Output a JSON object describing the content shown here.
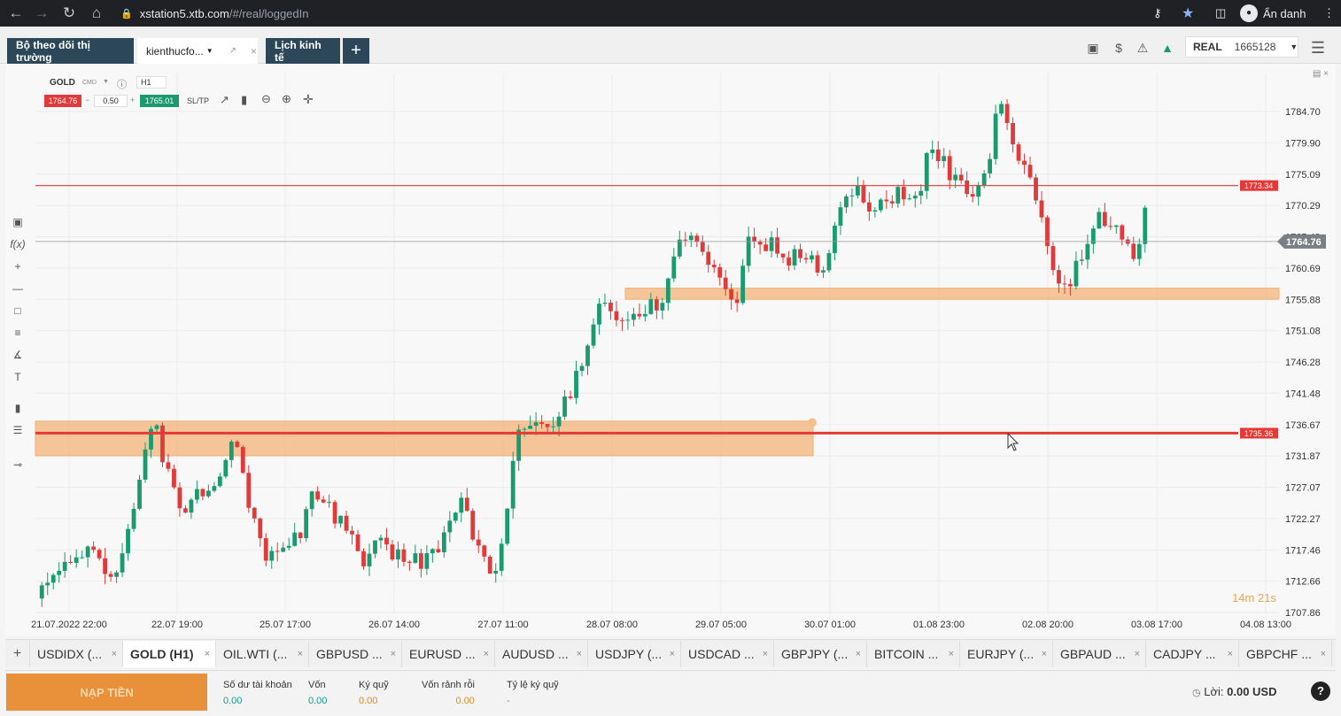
{
  "browser": {
    "url_host": "xstation5.xtb.com",
    "url_path": "/#/real/loggedIn",
    "profile_label": "Ẩn danh"
  },
  "header": {
    "tabs": [
      {
        "label": "Bộ theo dõi thị trường"
      },
      {
        "label": "kienthucfo...",
        "dropdown": true
      },
      {
        "label": "Lịch kinh tế"
      }
    ],
    "add_tab": "+",
    "account_type": "REAL",
    "account_number": "1665128"
  },
  "instrument": {
    "symbol": "GOLD",
    "type": "CMD",
    "timeframe": "H1",
    "sell_price": "1764.76",
    "volume": "0.50",
    "buy_price": "1765.01",
    "sltp_label": "SL/TP"
  },
  "chart_data": {
    "type": "candlestick",
    "y_axis_ticks": [
      "1784.70",
      "1779.90",
      "1775.09",
      "1770.29",
      "1765.49",
      "1760.69",
      "1755.88",
      "1751.08",
      "1746.28",
      "1741.48",
      "1736.67",
      "1731.87",
      "1727.07",
      "1722.27",
      "1717.46",
      "1712.66",
      "1707.86"
    ],
    "x_axis_ticks": [
      "21.07.2022 22:00",
      "22.07 19:00",
      "25.07 17:00",
      "26.07 14:00",
      "27.07 11:00",
      "28.07 08:00",
      "29.07 05:00",
      "30.07 01:00",
      "01.08 23:00",
      "02.08 20:00",
      "03.08 17:00",
      "04.08 13:00"
    ],
    "current_price": "1764.76",
    "horizontal_lines": [
      {
        "price": "1773.34",
        "color": "#e53935"
      },
      {
        "price": "1735.36",
        "color": "#e53935"
      }
    ],
    "zones": [
      {
        "from": 1731.9,
        "to": 1737.2,
        "color": "#f5a25a"
      },
      {
        "from": 1755.9,
        "to": 1757.6,
        "color": "#f5a25a"
      }
    ],
    "countdown": "14m 21s",
    "colors": {
      "up": "#1a9a6e",
      "down": "#e03a3a"
    },
    "grid": true
  },
  "instrument_tabs": [
    {
      "label": "USDIDX (..."
    },
    {
      "label": "GOLD (H1)",
      "active": true
    },
    {
      "label": "OIL.WTI (..."
    },
    {
      "label": "GBPUSD ..."
    },
    {
      "label": "EURUSD ..."
    },
    {
      "label": "AUDUSD ..."
    },
    {
      "label": "USDJPY (..."
    },
    {
      "label": "USDCAD ..."
    },
    {
      "label": "GBPJPY (..."
    },
    {
      "label": "BITCOIN ..."
    },
    {
      "label": "EURJPY (..."
    },
    {
      "label": "GBPAUD ..."
    },
    {
      "label": "CADJPY ..."
    },
    {
      "label": "GBPCHF ..."
    }
  ],
  "footer": {
    "deposit_label": "NẠP TIỀN",
    "stats": [
      {
        "label": "Số dư tài khoản",
        "value": "0.00"
      },
      {
        "label": "Vốn",
        "value": "0.00"
      },
      {
        "label": "Ký quỹ",
        "value": "0.00"
      },
      {
        "label": "Vốn rảnh rỗi",
        "value": "0.00"
      },
      {
        "label": "Tỷ lệ ký quỹ",
        "value": "-"
      }
    ],
    "profit_label": "Lời:",
    "profit_value": "0.00 USD"
  }
}
